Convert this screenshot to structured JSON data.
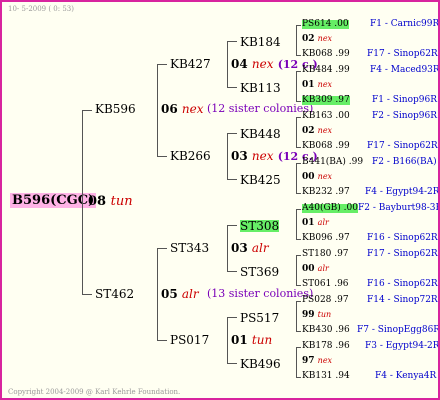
{
  "date_line": "10- 5-2009 ( 0: 53)",
  "copyright": "Copyright 2004-2009 @ Karl Kehrle Foundation.",
  "root": {
    "name": "B596(CGC)",
    "num": "08",
    "breed": "tun"
  },
  "gen1": {
    "top": {
      "name": "KB596",
      "num": "06",
      "breed": "nex",
      "sisters": "(12 sister colonies)"
    },
    "bottom": {
      "name": "ST462",
      "num": "05",
      "breed": "alr",
      "sisters": "(13 sister colonies)"
    }
  },
  "gen2": {
    "kb427": "KB427",
    "kb266": "KB266",
    "st343": "ST343",
    "ps017": "PS017",
    "kb427_num": "04",
    "kb427_breed": "nex",
    "kb427_extra": "(12 c.)",
    "kb266_num": "03",
    "kb266_breed": "nex",
    "kb266_extra": "(12 c.)",
    "st343_num": "03",
    "st343_breed": "alr",
    "ps017_num": "01",
    "ps017_breed": "tun"
  },
  "gen3": {
    "kb184": "KB184",
    "kb113": "KB113",
    "kb448": "KB448",
    "kb425": "KB425",
    "st308": "ST308",
    "st369": "ST369",
    "ps517": "PS517",
    "kb496": "KB496"
  },
  "leaves": [
    {
      "text": "PS614 .00",
      "src": "F1 - Carnic99R",
      "hl": true
    },
    {
      "text": "02",
      "breed": "nex"
    },
    {
      "text": "KB068 .99",
      "src": "F17 - Sinop62R"
    },
    {
      "text": "KB484 .99",
      "src": "F4 - Maced93R"
    },
    {
      "text": "01",
      "breed": "nex"
    },
    {
      "text": "KB309 .97",
      "src": "F1 - Sinop96R",
      "hl": true
    },
    {
      "text": "KB163 .00",
      "src": "F2 - Sinop96R"
    },
    {
      "text": "02",
      "breed": "nex"
    },
    {
      "text": "KB068 .99",
      "src": "F17 - Sinop62R"
    },
    {
      "text": "B441(BA) .99",
      "src": "F2 - B166(BA)"
    },
    {
      "text": "00",
      "breed": "nex"
    },
    {
      "text": "KB232 .97",
      "src": "F4 - Egypt94-2R"
    },
    {
      "text": "A40(GB) .00",
      "src": "F2 - Bayburt98-3R",
      "hl": true
    },
    {
      "text": "01",
      "breed": "alr"
    },
    {
      "text": "KB096 .97",
      "src": "F16 - Sinop62R"
    },
    {
      "text": "ST180 .97",
      "src": "F17 - Sinop62R"
    },
    {
      "text": "00",
      "breed": "alr"
    },
    {
      "text": "ST061 .96",
      "src": "F16 - Sinop62R"
    },
    {
      "text": "PS028 .97",
      "src": "F14 - Sinop72R"
    },
    {
      "text": "99",
      "breed": "tun"
    },
    {
      "text": "KB430 .96",
      "src": "F7 - SinopEgg86R"
    },
    {
      "text": "KB178 .96",
      "src": "F3 - Egypt94-2R"
    },
    {
      "text": "97",
      "breed": "nex"
    },
    {
      "text": "KB131 .94",
      "src": "F4 - Kenya4R"
    }
  ]
}
